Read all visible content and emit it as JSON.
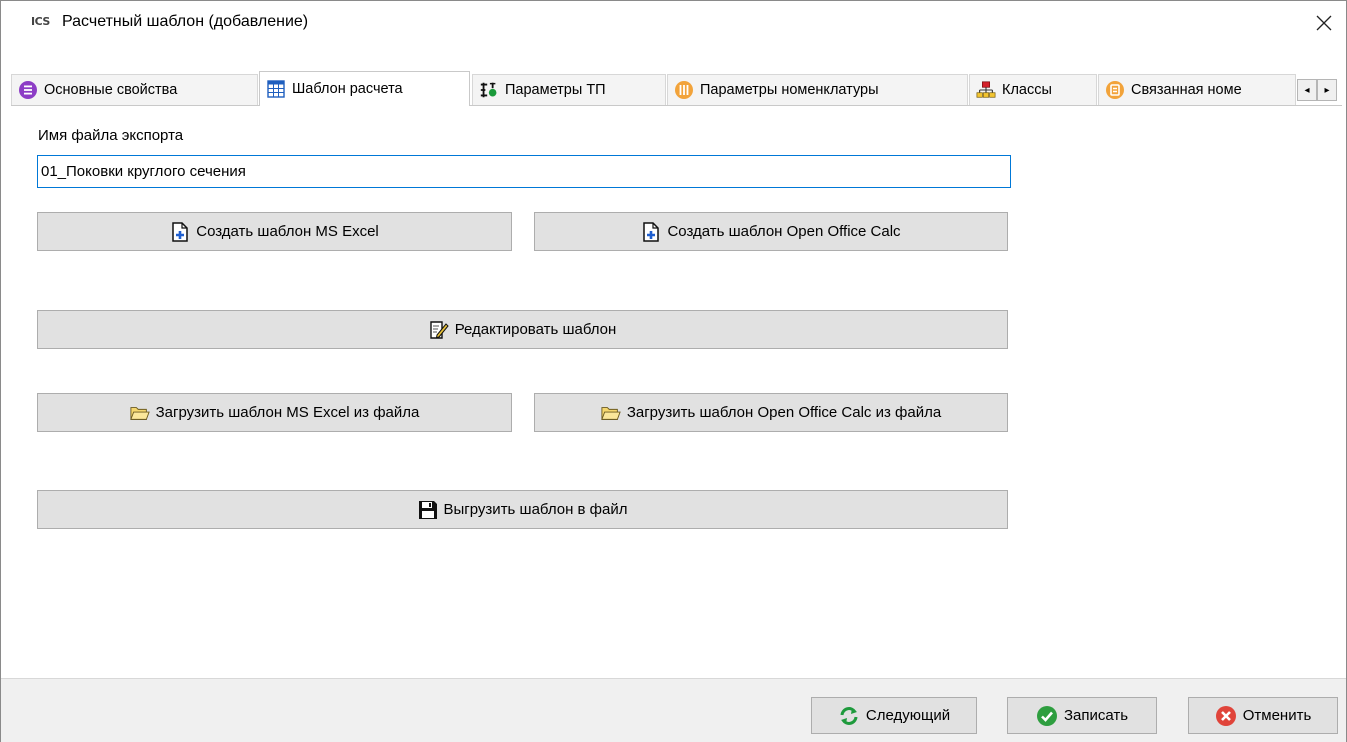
{
  "window": {
    "logo": "ICS",
    "title": "Расчетный шаблон (добавление)",
    "close_icon": "close-icon"
  },
  "tabs": [
    {
      "label": "Основные свойства",
      "icon": "list-circle-icon",
      "active": false
    },
    {
      "label": "Шаблон расчета",
      "icon": "table-icon",
      "active": true
    },
    {
      "label": "Параметры ТП",
      "icon": "process-params-icon",
      "active": false
    },
    {
      "label": "Параметры номенклатуры",
      "icon": "nomenclature-params-icon",
      "active": false
    },
    {
      "label": "Классы",
      "icon": "classes-hierarchy-icon",
      "active": false
    },
    {
      "label": "Связанная номе",
      "icon": "linked-nomenclature-icon",
      "active": false
    }
  ],
  "tab_scroll": {
    "left": "◂",
    "right": "▸"
  },
  "form": {
    "export_file_label": "Имя файла экспорта",
    "export_file_value": "01_Поковки круглого сечения"
  },
  "actions": {
    "create_excel": "Создать шаблон MS Excel",
    "create_calc": "Создать шаблон Open Office Calc",
    "edit_template": "Редактировать шаблон",
    "load_excel": "Загрузить шаблон MS Excel из файла",
    "load_calc": "Загрузить шаблон Open Office Calc из файла",
    "export_template": "Выгрузить шаблон в файл"
  },
  "footer": {
    "next": "Следующий",
    "save": "Записать",
    "cancel": "Отменить"
  },
  "colors": {
    "accent_border": "#0078d7",
    "button_face": "#e1e1e1",
    "footer_bg": "#f0f0f0",
    "ok_green": "#2e9e3f",
    "cancel_red": "#e0443a"
  }
}
